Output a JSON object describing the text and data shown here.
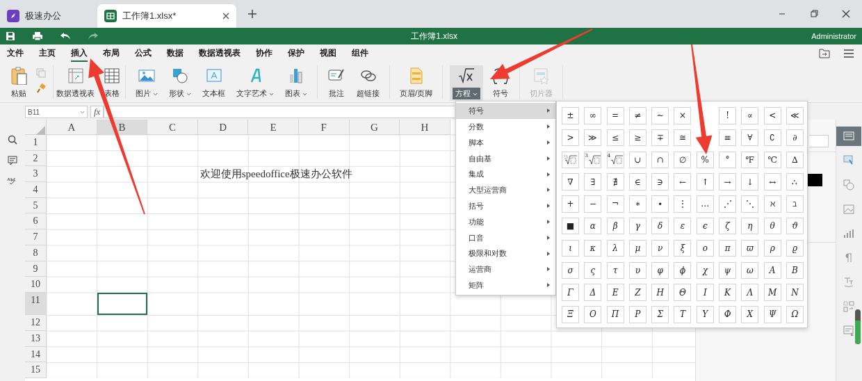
{
  "browser_tabs": [
    {
      "label": "极速办公",
      "selected": false,
      "closable": false
    },
    {
      "label": "工作簿1.xlsx*",
      "selected": true,
      "closable": true
    }
  ],
  "title_bar": {
    "title": "工作簿1.xlsx",
    "user": "Administrator"
  },
  "menu_tabs": [
    {
      "label": "文件",
      "selected": false
    },
    {
      "label": "主页",
      "selected": false
    },
    {
      "label": "插入",
      "selected": true
    },
    {
      "label": "布局",
      "selected": false
    },
    {
      "label": "公式",
      "selected": false
    },
    {
      "label": "数据",
      "selected": false
    },
    {
      "label": "数据透视表",
      "selected": false
    },
    {
      "label": "协作",
      "selected": false
    },
    {
      "label": "保护",
      "selected": false
    },
    {
      "label": "视图",
      "selected": false
    },
    {
      "label": "组件",
      "selected": false
    }
  ],
  "ribbon": [
    [
      {
        "label": "粘贴",
        "dropdown": false,
        "disabled": false,
        "pressed": false
      }
    ],
    [
      {
        "label": "数据透视表",
        "dropdown": false,
        "disabled": false,
        "pressed": false
      },
      {
        "label": "表格",
        "dropdown": false,
        "disabled": false,
        "pressed": false
      }
    ],
    [
      {
        "label": "图片",
        "dropdown": true,
        "disabled": false,
        "pressed": false
      },
      {
        "label": "形状",
        "dropdown": true,
        "disabled": false,
        "pressed": false
      },
      {
        "label": "文本框",
        "dropdown": false,
        "disabled": false,
        "pressed": false
      },
      {
        "label": "文字艺术",
        "dropdown": true,
        "disabled": false,
        "pressed": false
      },
      {
        "label": "图表",
        "dropdown": true,
        "disabled": false,
        "pressed": false
      }
    ],
    [
      {
        "label": "批注",
        "dropdown": false,
        "disabled": false,
        "pressed": false
      },
      {
        "label": "超链接",
        "dropdown": false,
        "disabled": false,
        "pressed": false
      }
    ],
    [
      {
        "label": "页眉/页脚",
        "dropdown": false,
        "disabled": false,
        "pressed": false
      }
    ],
    [
      {
        "label": "方程",
        "dropdown": true,
        "disabled": false,
        "pressed": true
      },
      {
        "label": "符号",
        "dropdown": false,
        "disabled": false,
        "pressed": false
      }
    ],
    [
      {
        "label": "切片器",
        "dropdown": false,
        "disabled": true,
        "pressed": false
      }
    ]
  ],
  "formula_bar": {
    "cell_name": "B11",
    "function_label": "fx"
  },
  "sheet": {
    "columns": [
      {
        "label": "A",
        "selected": false
      },
      {
        "label": "B",
        "selected": true
      },
      {
        "label": "C",
        "selected": false
      },
      {
        "label": "D",
        "selected": false
      },
      {
        "label": "E",
        "selected": false
      },
      {
        "label": "F",
        "selected": false
      },
      {
        "label": "G",
        "selected": false
      },
      {
        "label": "H",
        "selected": false
      }
    ],
    "rows": [
      {
        "label": "1",
        "selected": false
      },
      {
        "label": "2",
        "selected": false
      },
      {
        "label": "3",
        "selected": false,
        "text": "欢迎使用speedoffice极速办公软件"
      },
      {
        "label": "4",
        "selected": false
      },
      {
        "label": "5",
        "selected": false
      },
      {
        "label": "6",
        "selected": false
      },
      {
        "label": "7",
        "selected": false
      },
      {
        "label": "8",
        "selected": false
      },
      {
        "label": "9",
        "selected": false
      },
      {
        "label": "10",
        "selected": false
      },
      {
        "label": "11",
        "selected": true
      },
      {
        "label": "12",
        "selected": false
      },
      {
        "label": "13",
        "selected": false
      },
      {
        "label": "14",
        "selected": false
      },
      {
        "label": "15",
        "selected": false
      }
    ]
  },
  "equation_menu": [
    {
      "label": "符号",
      "selected": true
    },
    {
      "label": "分数",
      "selected": false
    },
    {
      "label": "脚本",
      "selected": false
    },
    {
      "label": "自由基",
      "selected": false
    },
    {
      "label": "集成",
      "selected": false
    },
    {
      "label": "大型运营商",
      "selected": false
    },
    {
      "label": "括号",
      "selected": false
    },
    {
      "label": "功能",
      "selected": false
    },
    {
      "label": "口音",
      "selected": false
    },
    {
      "label": "极限和对数",
      "selected": false
    },
    {
      "label": "运营商",
      "selected": false
    },
    {
      "label": "矩阵",
      "selected": false
    }
  ],
  "symbols": [
    [
      "±",
      "∞",
      "=",
      "≠",
      "~",
      "×",
      {
        "kind": "blank"
      },
      "!",
      "∝",
      "<",
      "≪"
    ],
    [
      ">",
      "≫",
      "≤",
      "≥",
      "∓",
      "≅",
      {
        "kind": "blank"
      },
      "≡",
      "∀",
      "∁",
      "∂"
    ],
    [
      {
        "kind": "radical"
      },
      {
        "kind": "radical",
        "index": "3"
      },
      {
        "kind": "radical",
        "index": "4"
      },
      "∪",
      "∩",
      "∅",
      "%",
      "°",
      "℉",
      "℃",
      "∆"
    ],
    [
      "∇",
      "∃",
      "∄",
      "∈",
      "∋",
      "←",
      "↑",
      "→",
      "↓",
      "↔",
      "∴"
    ],
    [
      "+",
      "−",
      "¬",
      "∗",
      "∙",
      "⋮",
      "…",
      "⋰",
      "⋱",
      "ℵ",
      "ℶ"
    ],
    [
      "■",
      "α",
      "β",
      "γ",
      "δ",
      "ε",
      "ϵ",
      "ζ",
      "η",
      "θ",
      "ϑ"
    ],
    [
      "ι",
      "κ",
      "λ",
      "μ",
      "ν",
      "ξ",
      "ο",
      "π",
      "ϖ",
      "ρ",
      "ϱ"
    ],
    [
      "σ",
      "ς",
      "τ",
      "υ",
      "φ",
      "ϕ",
      "χ",
      "ψ",
      "ω",
      "Α",
      "Β"
    ],
    [
      "Γ",
      "Δ",
      "Ε",
      "Ζ",
      "Η",
      "Θ",
      "Ι",
      "Κ",
      "Λ",
      "Μ",
      "Ν"
    ],
    [
      "Ξ",
      "Ο",
      "Π",
      "Ρ",
      "Σ",
      "Τ",
      "Υ",
      "Φ",
      "Χ",
      "Ψ",
      "Ω"
    ]
  ],
  "right_toolbar": [
    {
      "selected": true
    },
    {
      "selected": false
    },
    {
      "selected": false
    },
    {
      "selected": false
    },
    {
      "selected": false
    },
    {
      "selected": false
    },
    {
      "selected": false
    },
    {
      "selected": false
    },
    {
      "selected": false
    }
  ],
  "zoom_meter": {
    "level": 0.68
  }
}
